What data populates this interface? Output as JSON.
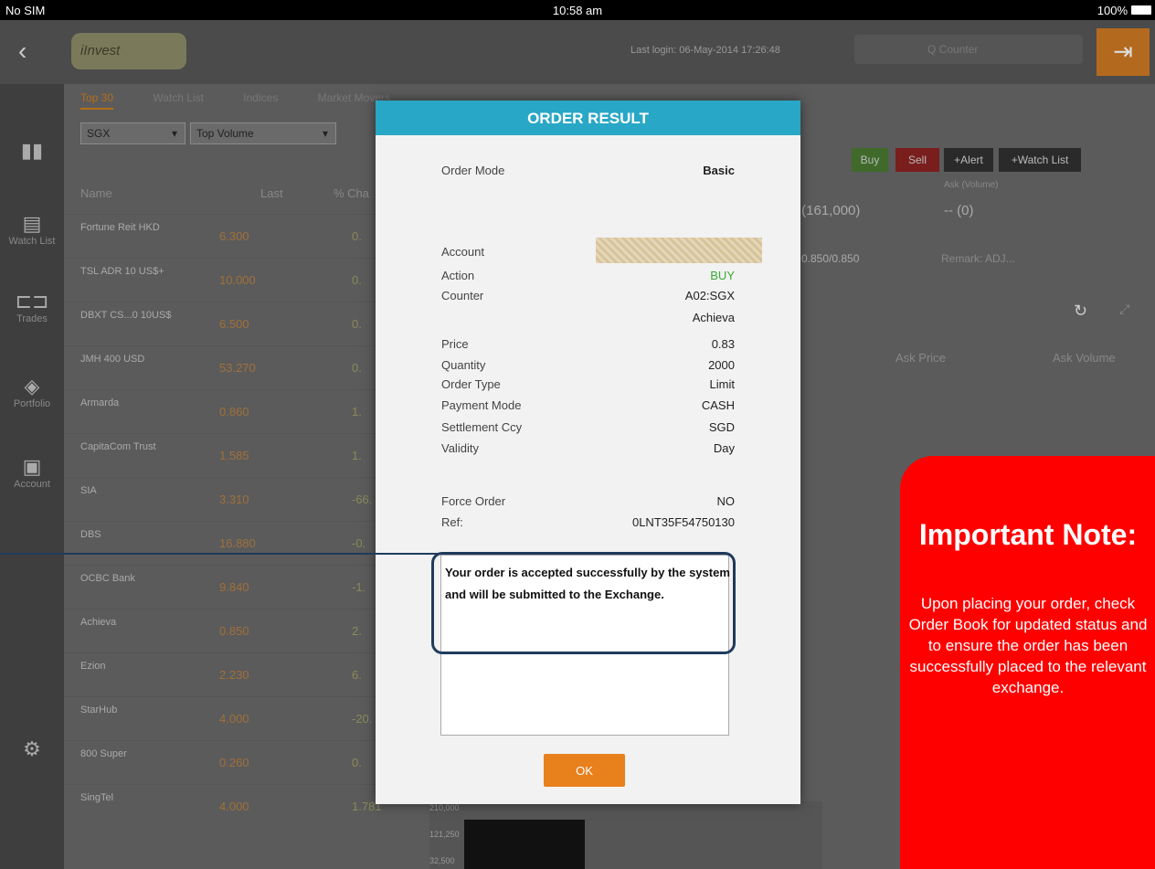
{
  "status_bar": {
    "carrier": "No SIM",
    "time": "10:58 am",
    "battery": "100%"
  },
  "header": {
    "logo_text": "iInvest",
    "last_login": "Last login: 06-May-2014 17:26:48",
    "search_placeholder": "Q  Counter"
  },
  "sidebar": {
    "items": [
      {
        "icon": "chart-icon",
        "label": ""
      },
      {
        "icon": "document-icon",
        "label": "Watch List"
      },
      {
        "icon": "trades-icon",
        "label": "Trades"
      },
      {
        "icon": "portfolio-icon",
        "label": "Portfolio"
      },
      {
        "icon": "account-icon",
        "label": "Account"
      },
      {
        "icon": "settings-icon",
        "label": ""
      }
    ]
  },
  "tabs": [
    "Top 30",
    "Watch List",
    "Indices",
    "Market Movers"
  ],
  "filters": {
    "exchange": "SGX",
    "sort": "Top Volume"
  },
  "list_header": {
    "name": "Name",
    "last": "Last",
    "change": "% Cha"
  },
  "stocks": [
    {
      "name": "Fortune Reit HKD",
      "last": "6.300",
      "change": "0."
    },
    {
      "name": "TSL ADR 10 US$+",
      "last": "10.000",
      "change": "0."
    },
    {
      "name": "DBXT CS...0 10US$",
      "last": "6.500",
      "change": "0."
    },
    {
      "name": "JMH 400 USD",
      "last": "53.270",
      "change": "0."
    },
    {
      "name": "Armarda",
      "last": "0.860",
      "change": "1."
    },
    {
      "name": "CapitaCom Trust",
      "last": "1.585",
      "change": "1."
    },
    {
      "name": "SIA",
      "last": "3.310",
      "change": "-66."
    },
    {
      "name": "DBS",
      "last": "16.880",
      "change": "-0."
    },
    {
      "name": "OCBC Bank",
      "last": "9.840",
      "change": "-1."
    },
    {
      "name": "Achieva",
      "last": "0.850",
      "change": "2."
    },
    {
      "name": "Ezion",
      "last": "2.230",
      "change": "6."
    },
    {
      "name": "StarHub",
      "last": "4.000",
      "change": "-20."
    },
    {
      "name": "800 Super",
      "last": "0.260",
      "change": "0."
    },
    {
      "name": "SingTel",
      "last": "4.000",
      "change": "1.781"
    }
  ],
  "action_buttons": {
    "buy": "Buy",
    "sell": "Sell",
    "alert": "+Alert",
    "watchlist": "+Watch List"
  },
  "background_detail": {
    "bid_value": ") (161,000)",
    "ask_label": "Ask (Volume)",
    "ask_value": "-- (0)",
    "range": "0.850/0.850",
    "remark": "Remark: ADJ...",
    "ask_price": "Ask Price",
    "ask_volume": "Ask Volume",
    "vol1": "210,000",
    "vol2": "121,250",
    "vol3": "32,500"
  },
  "modal": {
    "title": "ORDER RESULT",
    "order_mode_label": "Order Mode",
    "order_mode": "Basic",
    "account_label": "Account",
    "action_label": "Action",
    "action": "BUY",
    "counter_label": "Counter",
    "counter": "A02:SGX",
    "counter_name": "Achieva",
    "price_label": "Price",
    "price": "0.83",
    "quantity_label": "Quantity",
    "quantity": "2000",
    "order_type_label": "Order Type",
    "order_type": "Limit",
    "payment_mode_label": "Payment Mode",
    "payment_mode": "CASH",
    "settlement_label": "Settlement Ccy",
    "settlement": "SGD",
    "validity_label": "Validity",
    "validity": "Day",
    "force_order_label": "Force Order",
    "force_order": "NO",
    "ref_label": "Ref:",
    "ref": "0LNT35F54750130",
    "message": "Your order is accepted successfully by the system and will be submitted to the Exchange.",
    "ok": "OK"
  },
  "note": {
    "title": "Important Note:",
    "body": "Upon placing your order, check Order Book for updated status and to ensure the order has been successfully placed to the relevant exchange."
  },
  "colors": {
    "accent": "#28a7c6",
    "ok_button": "#e8801c",
    "note_bg": "#ff0000",
    "buy_text": "#3aaa35"
  }
}
